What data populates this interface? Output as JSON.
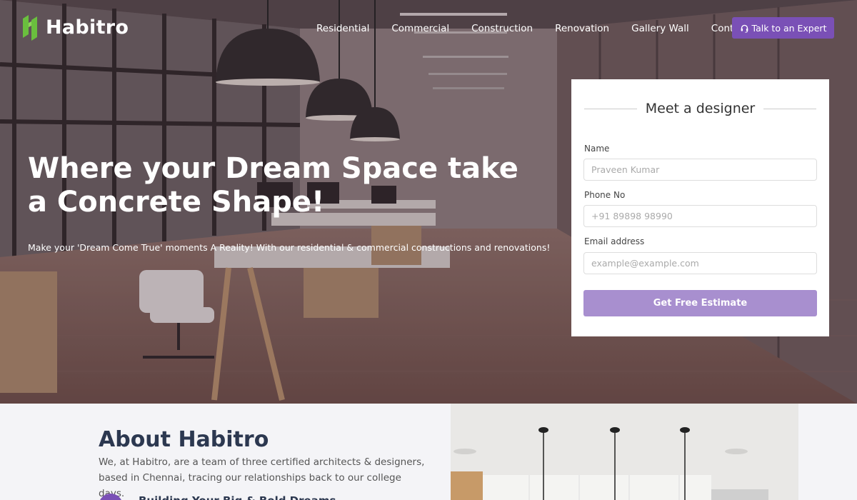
{
  "brand": {
    "name": "Habitro",
    "logo_icon": "habitro-logo-icon"
  },
  "nav": {
    "items": [
      {
        "label": "Residential"
      },
      {
        "label": "Commercial"
      },
      {
        "label": "Construction"
      },
      {
        "label": "Renovation"
      },
      {
        "label": "Gallery Wall"
      },
      {
        "label": "Contact"
      }
    ],
    "cta": {
      "label": "Talk to an Expert",
      "icon": "headset-icon"
    }
  },
  "hero": {
    "title": "Where your Dream Space take a Concrete Shape!",
    "subtitle": "Make your 'Dream Come True' moments A Reality! With our residential & commercial constructions and renovations!"
  },
  "form": {
    "title": "Meet a designer",
    "fields": {
      "name": {
        "label": "Name",
        "placeholder": "Praveen Kumar"
      },
      "phone": {
        "label": "Phone No",
        "placeholder": "+91 89898 98990"
      },
      "email": {
        "label": "Email address",
        "placeholder": "example@example.com"
      }
    },
    "submit_label": "Get Free Estimate"
  },
  "about": {
    "title": "About Habitro",
    "text": "We, at Habitro, are a team of three certified architects & designers, based in Chennai, tracing our relationships back to our college days.",
    "subheading": "Building Your Big & Bold Dreams"
  },
  "colors": {
    "accent": "#7a50b6",
    "accent_light": "#a88fcf",
    "heading": "#2c3850"
  }
}
